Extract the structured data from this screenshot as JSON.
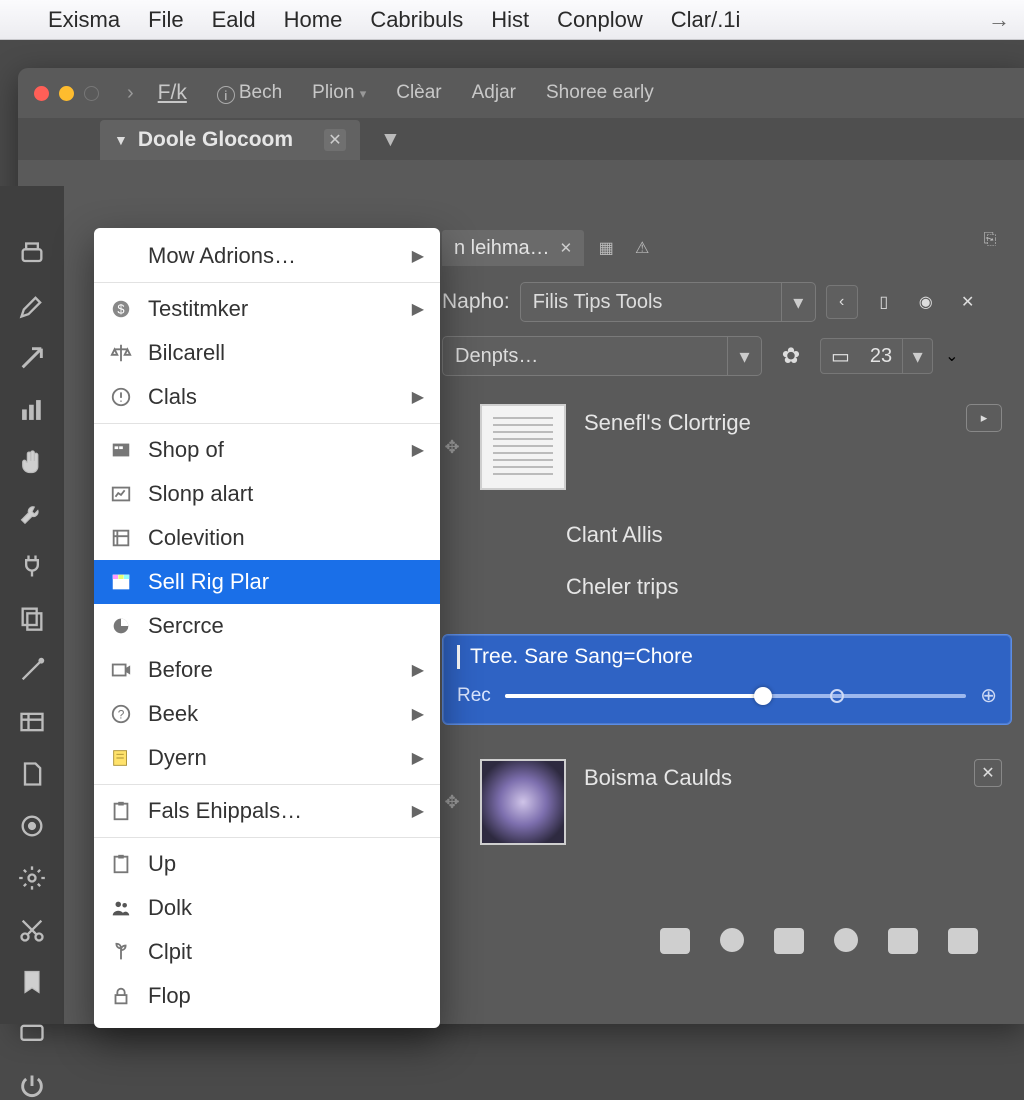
{
  "menubar": {
    "items": [
      "Exisma",
      "File",
      "Eald",
      "Home",
      "Cabribuls",
      "Hist",
      "Conplow",
      "Clar/.1i"
    ]
  },
  "titlebar": {
    "back_fwd": "›",
    "path": "F/k",
    "bech": "Bech",
    "plion": "Plion",
    "clear": "Clèar",
    "adjar": "Adjar",
    "shore": "Shoree early"
  },
  "main_tab": {
    "label": "Doole Glocoom"
  },
  "sub_tab": {
    "label": "n leihma…"
  },
  "napho": {
    "label": "Napho:",
    "value": "Filis Tips Tools"
  },
  "dents": {
    "value": "Denpts…",
    "number": "23"
  },
  "dropdown": {
    "items": [
      {
        "label": "Mow Adrions…",
        "icon": "",
        "sub": true
      },
      {
        "label": "Testitmker",
        "icon": "dollar",
        "sub": true
      },
      {
        "label": "Bilcarell",
        "icon": "scale",
        "sub": false
      },
      {
        "label": "Clals",
        "icon": "alert",
        "sub": true
      },
      {
        "label": "Shop of",
        "icon": "grid",
        "sub": true
      },
      {
        "label": "Slonp alart",
        "icon": "chart",
        "sub": false
      },
      {
        "label": "Colevition",
        "icon": "board",
        "sub": false
      },
      {
        "label": "Sell Rig Plar",
        "icon": "color",
        "sub": false,
        "selected": true
      },
      {
        "label": "Sercrce",
        "icon": "pie",
        "sub": false
      },
      {
        "label": "Before",
        "icon": "video",
        "sub": true
      },
      {
        "label": "Beek",
        "icon": "help",
        "sub": true
      },
      {
        "label": "Dyern",
        "icon": "note",
        "sub": true
      },
      {
        "label": "Fals Ehippals…",
        "icon": "clip",
        "sub": true
      },
      {
        "label": "Up",
        "icon": "clip2",
        "sub": false
      },
      {
        "label": "Dolk",
        "icon": "people",
        "sub": false
      },
      {
        "label": "Clpit",
        "icon": "plant",
        "sub": false
      },
      {
        "label": "Flop",
        "icon": "lock",
        "sub": false
      }
    ]
  },
  "list": {
    "item1": "Senefl's Clortrige",
    "item2": "Clant Allis",
    "item3": "Cheler trips",
    "sel_title": "Tree. Sare Sang=Chore",
    "sel_left": "Rec",
    "item4": "Boisma Caulds"
  }
}
